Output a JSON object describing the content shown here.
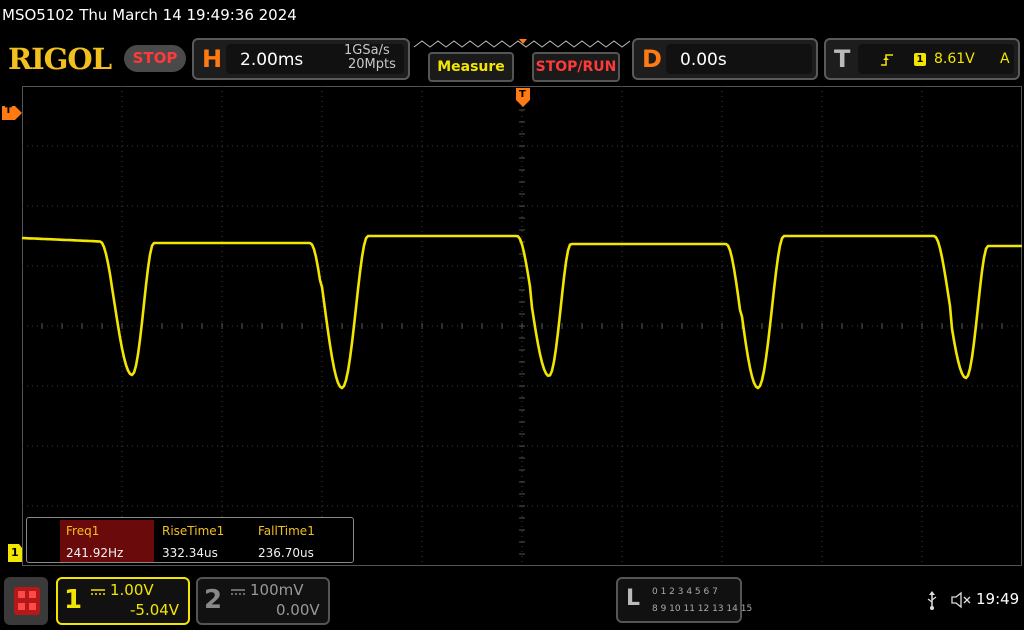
{
  "header": {
    "title": "MSO5102  Thu March 14 19:49:36 2024",
    "logo": "RIGOL",
    "run_state": "STOP"
  },
  "horizontal": {
    "letter": "H",
    "timebase": "2.00ms",
    "sample_rate": "1GSa/s",
    "memory_depth": "20Mpts"
  },
  "buttons": {
    "measure": "Measure",
    "stop_run": "STOP/RUN"
  },
  "delay": {
    "letter": "D",
    "value": "0.00s"
  },
  "trigger": {
    "letter": "T",
    "source": "1",
    "level": "8.61V",
    "mode": "A",
    "marker_label": "T"
  },
  "measurements": [
    {
      "name": "Freq1",
      "value": "241.92Hz"
    },
    {
      "name": "RiseTime1",
      "value": "332.34us"
    },
    {
      "name": "FallTime1",
      "value": "236.70us"
    }
  ],
  "channel1": {
    "number": "1",
    "scale": "1.00V",
    "offset": "-5.04V",
    "marker": "1"
  },
  "channel2": {
    "number": "2",
    "scale": "100mV",
    "offset": "0.00V"
  },
  "logic": {
    "letter": "L",
    "row1": "0 1 2 3  4 5 6 7",
    "row2": "8  9 10 11  12 13 14 15"
  },
  "status": {
    "time": "19:49"
  },
  "colors": {
    "trace": "#f2e600",
    "accent": "#ff7a12",
    "stop": "#ff3a3a"
  },
  "icons": [
    "usb-icon",
    "speaker-muted-icon",
    "menu-grid-icon",
    "trigger-edge-icon"
  ]
}
